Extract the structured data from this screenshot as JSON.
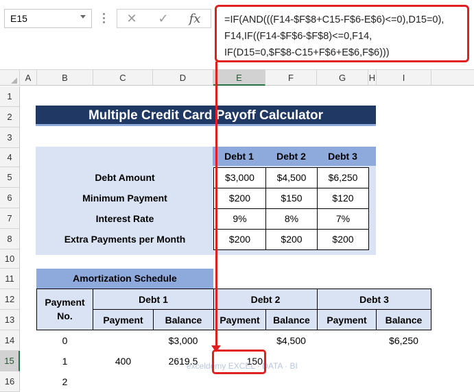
{
  "formula_bar": {
    "name_box": "E15",
    "cancel_icon": "✕",
    "enter_icon": "✓",
    "fx_icon": "fx",
    "formula": "=IF(AND(((F14-$F$8+C15-F$6-E$6)<=0),D15=0),\nF14,IF((F14-$F$6-$F$8)<=0,F14,\nIF(D15=0,$F$8-C15+F$6+E$6,F$6)))"
  },
  "columns": [
    "A",
    "B",
    "C",
    "D",
    "E",
    "F",
    "G",
    "H",
    "I"
  ],
  "rows": [
    "1",
    "2",
    "3",
    "4",
    "5",
    "6",
    "7",
    "8",
    "10",
    "11",
    "12",
    "13",
    "14",
    "15",
    "16"
  ],
  "selected_cell": "E15",
  "title": "Multiple Credit Card Payoff Calculator",
  "input_table": {
    "headers": [
      "Debt 1",
      "Debt 2",
      "Debt 3"
    ],
    "rows": [
      {
        "label": "Debt Amount",
        "values": [
          "$3,000",
          "$4,500",
          "$6,250"
        ]
      },
      {
        "label": "Minimum Payment",
        "values": [
          "$200",
          "$150",
          "$120"
        ]
      },
      {
        "label": "Interest Rate",
        "values": [
          "9%",
          "8%",
          "7%"
        ]
      },
      {
        "label": "Extra Payments per Month",
        "values": [
          "$200",
          "$200",
          "$200"
        ]
      }
    ]
  },
  "amortization": {
    "title": "Amortization Schedule",
    "payment_no_header": "Payment No.",
    "debt_headers": [
      "Debt 1",
      "Debt 2",
      "Debt 3"
    ],
    "sub_headers": [
      "Payment",
      "Balance",
      "Payment",
      "Balance",
      "Payment",
      "Balance"
    ],
    "rows": [
      {
        "no": "0",
        "cells": [
          "",
          "$3,000",
          "",
          "$4,500",
          "",
          "$6,250"
        ]
      },
      {
        "no": "1",
        "cells": [
          "400",
          "2619.5",
          "150",
          "",
          "",
          ""
        ]
      },
      {
        "no": "2",
        "cells": [
          "",
          "",
          "",
          "",
          "",
          ""
        ]
      }
    ]
  },
  "watermark": "exceldemy EXCEL · DATA · BI",
  "colors": {
    "title_bg": "#203864",
    "header_bg": "#8ea9db",
    "label_bg": "#dae3f3",
    "highlight": "#e02020",
    "selection": "#217346"
  }
}
